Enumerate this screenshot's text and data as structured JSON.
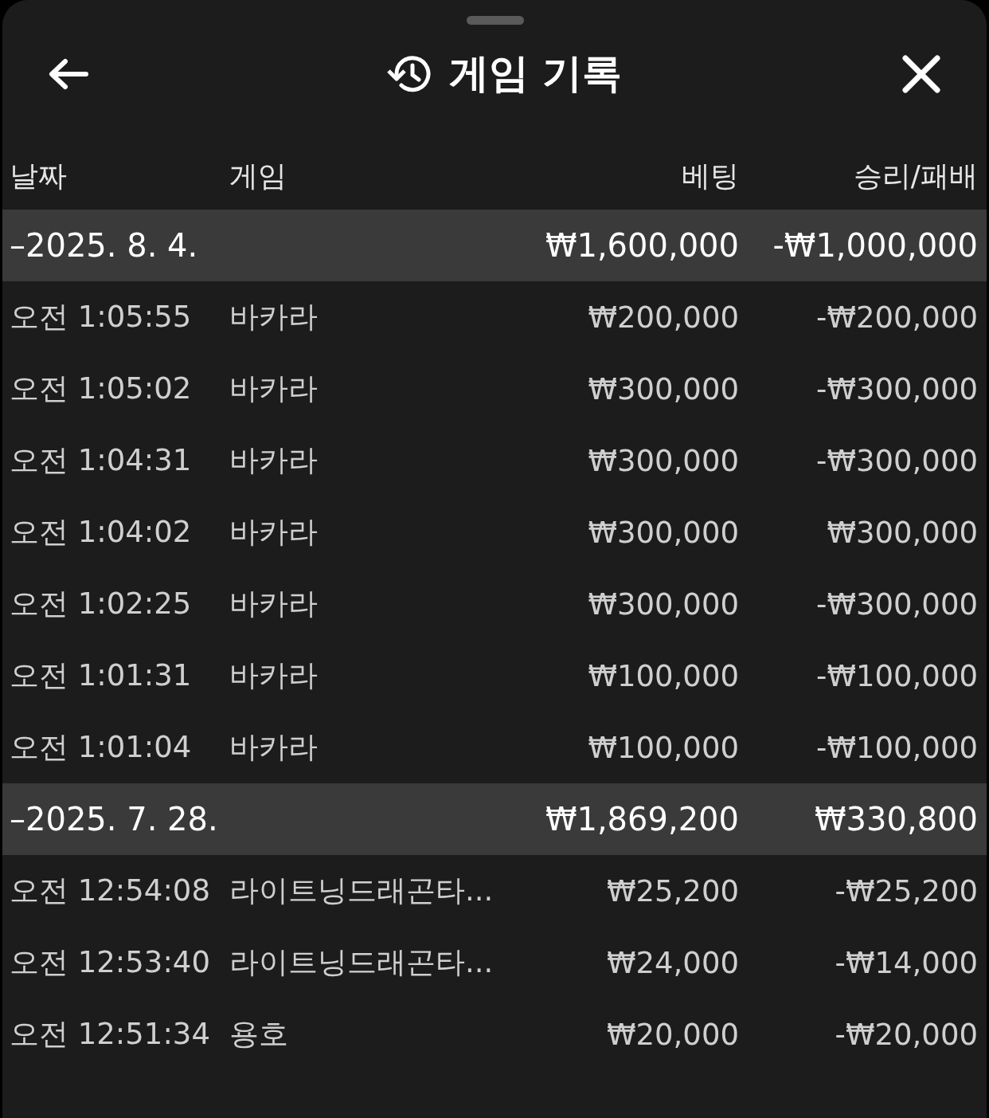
{
  "header": {
    "title": "게임 기록"
  },
  "columns": [
    "날짜",
    "게임",
    "베팅",
    "승리/패배"
  ],
  "groups": [
    {
      "date": "–2025. 8. 4.",
      "bet": "₩1,600,000",
      "result": "-₩1,000,000",
      "rows": [
        {
          "time": "오전 1:05:55",
          "game": "바카라",
          "bet": "₩200,000",
          "result": "-₩200,000"
        },
        {
          "time": "오전 1:05:02",
          "game": "바카라",
          "bet": "₩300,000",
          "result": "-₩300,000"
        },
        {
          "time": "오전 1:04:31",
          "game": "바카라",
          "bet": "₩300,000",
          "result": "-₩300,000"
        },
        {
          "time": "오전 1:04:02",
          "game": "바카라",
          "bet": "₩300,000",
          "result": "₩300,000"
        },
        {
          "time": "오전 1:02:25",
          "game": "바카라",
          "bet": "₩300,000",
          "result": "-₩300,000"
        },
        {
          "time": "오전 1:01:31",
          "game": "바카라",
          "bet": "₩100,000",
          "result": "-₩100,000"
        },
        {
          "time": "오전 1:01:04",
          "game": "바카라",
          "bet": "₩100,000",
          "result": "-₩100,000"
        }
      ]
    },
    {
      "date": "–2025. 7. 28.",
      "bet": "₩1,869,200",
      "result": "₩330,800",
      "rows": [
        {
          "time": "오전 12:54:08",
          "game": "라이트닝드래곤타...",
          "bet": "₩25,200",
          "result": "-₩25,200"
        },
        {
          "time": "오전 12:53:40",
          "game": "라이트닝드래곤타...",
          "bet": "₩24,000",
          "result": "-₩14,000"
        },
        {
          "time": "오전 12:51:34",
          "game": "용호",
          "bet": "₩20,000",
          "result": "-₩20,000"
        }
      ]
    }
  ]
}
